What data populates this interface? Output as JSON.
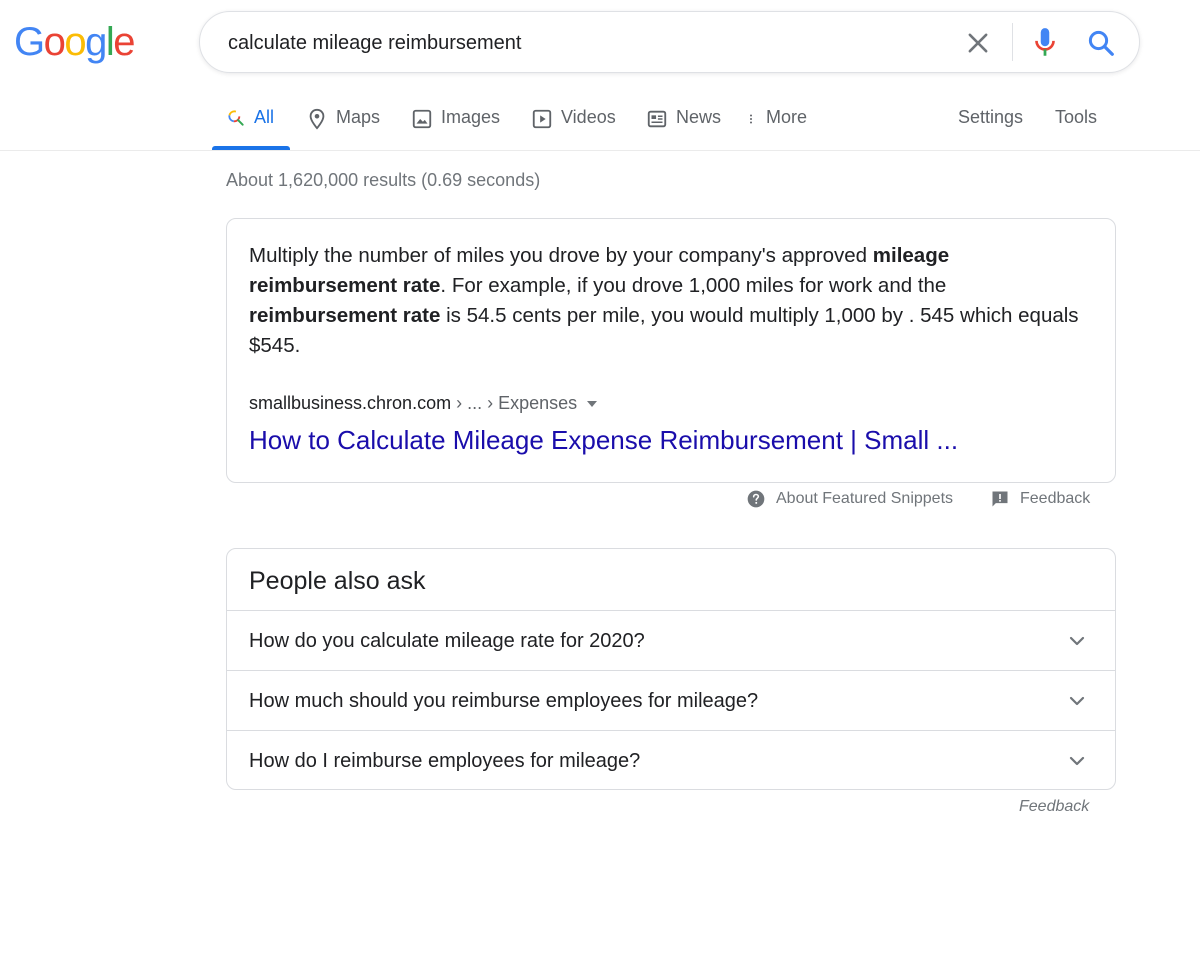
{
  "logo": {
    "letters": [
      "G",
      "o",
      "o",
      "g",
      "l",
      "e"
    ],
    "colors": [
      "#4285F4",
      "#EA4335",
      "#FBBC05",
      "#4285F4",
      "#34A853",
      "#EA4335"
    ]
  },
  "search": {
    "query": "calculate mileage reimbursement"
  },
  "tabs": {
    "all": "All",
    "maps": "Maps",
    "images": "Images",
    "videos": "Videos",
    "news": "News",
    "more": "More",
    "settings": "Settings",
    "tools": "Tools"
  },
  "result_stats": "About 1,620,000 results (0.69 seconds)",
  "featured_snippet": {
    "text_parts": [
      {
        "text": "Multiply the number of miles you drove by your company's approved ",
        "bold": false
      },
      {
        "text": "mileage reimbursement rate",
        "bold": true
      },
      {
        "text": ". For example, if you drove 1,000 miles for work and the ",
        "bold": false
      },
      {
        "text": "reimbursement rate",
        "bold": true
      },
      {
        "text": " is 54.5 cents per mile, you would multiply 1,000 by . 545 which equals $545.",
        "bold": false
      }
    ],
    "cite_domain": "smallbusiness.chron.com",
    "cite_path": " › ... › Expenses",
    "link_title": "How to Calculate Mileage Expense Reimbursement | Small ...",
    "about_label": "About Featured Snippets",
    "feedback_label": "Feedback"
  },
  "people_also_ask": {
    "title": "People also ask",
    "questions": [
      "How do you calculate mileage rate for 2020?",
      "How much should you reimburse employees for mileage?",
      "How do I reimburse employees for mileage?"
    ],
    "feedback_label": "Feedback"
  },
  "colors": {
    "accent": "#1a73e8",
    "link": "#1a0dab",
    "secondary_text": "#70757a"
  }
}
